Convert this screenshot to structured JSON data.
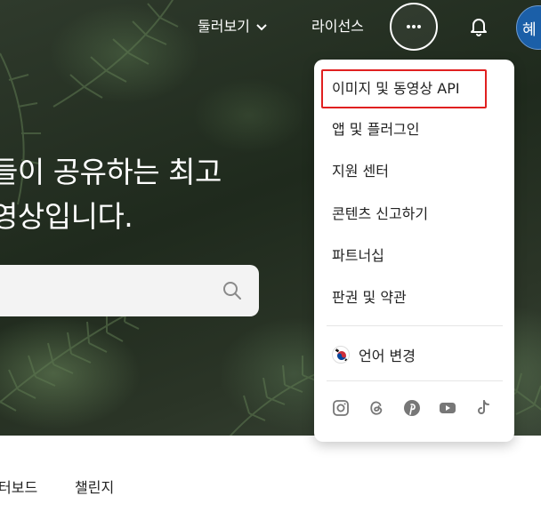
{
  "nav": {
    "explore_label": "둘러보기",
    "license_label": "라이선스",
    "avatar_text": "혜"
  },
  "hero": {
    "headline_line1": "들이 공유하는 최고",
    "headline_line2": "영상입니다."
  },
  "tabs": [
    {
      "label": "터보드"
    },
    {
      "label": "챌린지"
    }
  ],
  "menu": {
    "items": [
      {
        "label": "이미지 및 동영상 API"
      },
      {
        "label": "앱 및 플러그인"
      },
      {
        "label": "지원 센터"
      },
      {
        "label": "콘텐츠 신고하기"
      },
      {
        "label": "파트너십"
      },
      {
        "label": "판권 및 약관"
      }
    ],
    "language_label": "언어 변경",
    "socials": [
      "instagram-icon",
      "threads-icon",
      "pinterest-icon",
      "youtube-icon",
      "tiktok-icon"
    ]
  },
  "colors": {
    "highlight_border": "#e02020",
    "avatar_bg": "#1b5fa8"
  }
}
